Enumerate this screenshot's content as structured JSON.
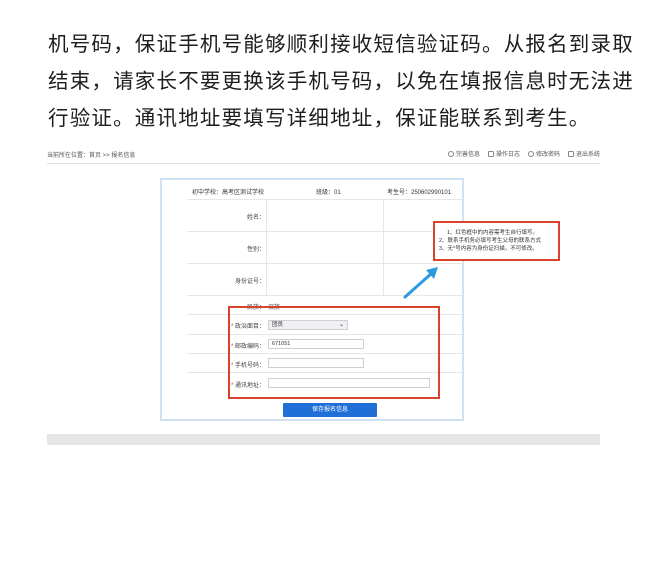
{
  "paragraph": {
    "line1": "机号码，保证手机号能够顺利接收短信验证码。从报名到录取",
    "line2": "结束，请家长不要更换该手机号码，以免在填报信息时无法进",
    "line3": "行验证。通讯地址要填写详细地址，保证能联系到考生。"
  },
  "screenshot": {
    "breadcrumb": "当前所在位置：首页 >> 报名信息",
    "nav": [
      "完善信息",
      "操作日志",
      "修改密码",
      "退出系统"
    ],
    "info": {
      "school": "初中学校：高考区测试学校",
      "class": "班级：01",
      "exam_no": "考生号：250602990101"
    },
    "rows": {
      "name_label": "姓名：",
      "gender_label": "性别：",
      "id_label": "身份证号：",
      "ethnicity_label": "民族：",
      "ethnicity_value": "汉族",
      "political_label": "政治面目：",
      "political_value": "团员",
      "postcode_label": "邮政编码：",
      "postcode_value": "671051",
      "phone_label": "手机号码：",
      "address_label": "通讯地址：",
      "required_mark": "*"
    },
    "save_button": "保存报名信息",
    "note": {
      "line1": "1、红色框中的内容需考生自行填写。",
      "line2": "2、联系手机务必填写考生父母的联系方式",
      "line3": "3、无*号内容为身份证扫描，不可修改。"
    },
    "colors": {
      "highlight": "#d9432b",
      "button": "#1f6fd6",
      "arrow": "#2b9be0"
    }
  }
}
